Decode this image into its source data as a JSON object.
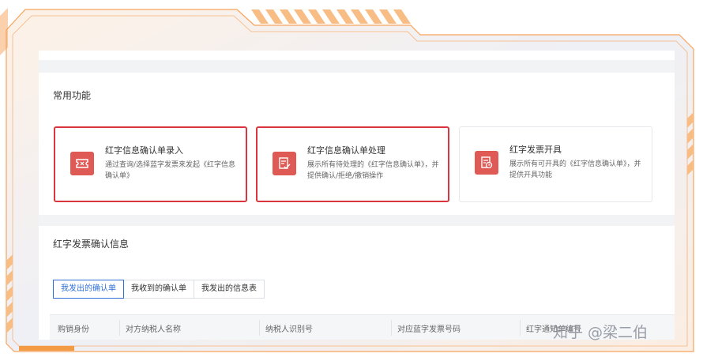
{
  "common_functions": {
    "title": "常用功能",
    "cards": [
      {
        "title": "红字信息确认单录入",
        "desc": "通过查询/选择蓝字发票来发起《红字信息确认单》",
        "icon": "ticket-icon",
        "highlighted": true
      },
      {
        "title": "红字信息确认单处理",
        "desc": "展示所有待处理的《红字信息确认单》，并提供确认/拒绝/撤销操作",
        "icon": "document-check-icon",
        "highlighted": true
      },
      {
        "title": "红字发票开具",
        "desc": "展示所有可开具的《红字信息确认单》，并提供开具功能",
        "icon": "invoice-clock-icon",
        "highlighted": false
      }
    ]
  },
  "red_invoice_info": {
    "title": "红字发票确认信息",
    "tabs": [
      "我发出的确认单",
      "我收到的确认单",
      "我发出的信息表"
    ],
    "active_tab": "我发出的确认单",
    "columns": [
      "购销身份",
      "对方纳税人名称",
      "纳税人识别号",
      "对应蓝字发票号码",
      "红字通知单编号"
    ]
  },
  "watermark": "知乎 @梁二伯",
  "colors": {
    "accent_red": "#d9363e",
    "icon_red": "#e05a55",
    "frame_orange": "#f7a35c",
    "tab_blue": "#2f6fd8"
  }
}
